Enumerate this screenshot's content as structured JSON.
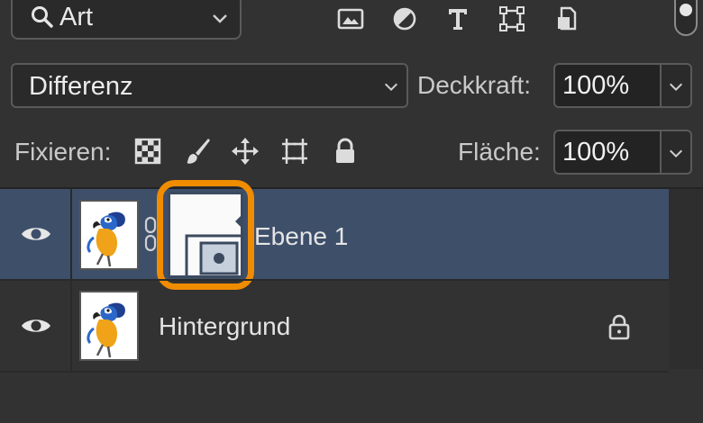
{
  "filter": {
    "label": "Art",
    "search_icon": "search-icon",
    "dropdown_icon": "chevron-down-icon"
  },
  "filter_icons": [
    "image-icon",
    "adjustment-icon",
    "text-icon",
    "shape-icon",
    "smart-object-icon"
  ],
  "blend": {
    "mode": "Differenz"
  },
  "opacity": {
    "label": "Deckkraft:",
    "value": "100%"
  },
  "lock": {
    "label": "Fixieren:",
    "icons": [
      "lock-transparency-icon",
      "lock-brush-icon",
      "lock-move-icon",
      "lock-artboard-icon",
      "lock-all-icon"
    ]
  },
  "fill": {
    "label": "Fläche:",
    "value": "100%"
  },
  "layers": [
    {
      "name": "Ebene 1",
      "selected": true,
      "has_mask": true,
      "locked": false
    },
    {
      "name": "Hintergrund",
      "selected": false,
      "has_mask": false,
      "locked": true
    }
  ],
  "colors": {
    "panel": "#323232",
    "selected_row": "#3e4f6a",
    "highlight": "#f08c00"
  }
}
